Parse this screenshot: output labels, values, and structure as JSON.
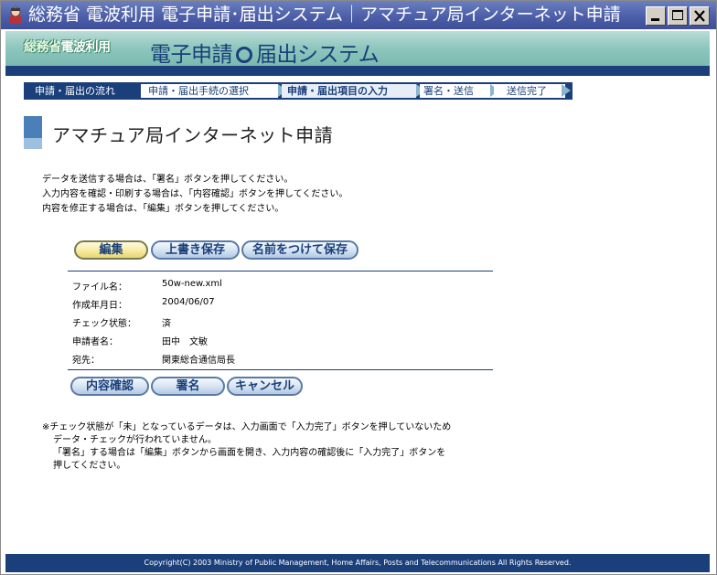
{
  "window": {
    "title": "総務省 電波利用 電子申請･届出システム｜アマチュア局インターネット申請",
    "controls": {
      "minimize": "_",
      "maximize": "□",
      "close": "X"
    }
  },
  "banner": {
    "ministry_part1": "総務省",
    "ministry_part2": "電波利用",
    "system_part1": "電子申請",
    "system_part2": "届出システム"
  },
  "steps": [
    {
      "label": "申請・届出の流れ"
    },
    {
      "label": "申請・届出手続の選択"
    },
    {
      "label": "申請・届出項目の入力",
      "active": true
    },
    {
      "label": "署名・送信"
    },
    {
      "label": "送信完了"
    }
  ],
  "page_title": "アマチュア局インターネット申請",
  "instructions": [
    "データを送信する場合は、「署名」ボタンを押してください。",
    "入力内容を確認・印刷する場合は、「内容確認」ボタンを押してください。",
    "内容を修正する場合は、「編集」ボタンを押してください。"
  ],
  "top_buttons": {
    "edit": "編集",
    "overwrite": "上書き保存",
    "save_as": "名前をつけて保存"
  },
  "info": [
    {
      "label": "ファイル名：",
      "value": "50w-new.xml"
    },
    {
      "label": "作成年月日：",
      "value": "2004/06/07"
    },
    {
      "label": "チェック状態：",
      "value": "済"
    },
    {
      "label": "申請者名：",
      "value": "田中　文敏"
    },
    {
      "label": "宛先：",
      "value": "関東総合通信局長"
    }
  ],
  "bottom_buttons": {
    "confirm": "内容確認",
    "sign": "署名",
    "cancel": "キャンセル"
  },
  "notes": [
    "※チェック状態が「未」となっているデータは、入力画面で「入力完了」ボタンを押していないため",
    "データ・チェックが行われていません。",
    "「署名」する場合は「編集」ボタンから画面を開き、入力内容の確認後に「入力完了」ボタンを",
    "押してください。"
  ],
  "footer": "Copyright(C) 2003 Ministry of Public Management, Home Affairs, Posts and Telecommunications All Rights Reserved.",
  "colors": {
    "navy": "#1a3f7a",
    "banner_teal": "#8cc6bd",
    "title_bar": "#4d5fa8",
    "edit_button": "#f6eaa0"
  }
}
